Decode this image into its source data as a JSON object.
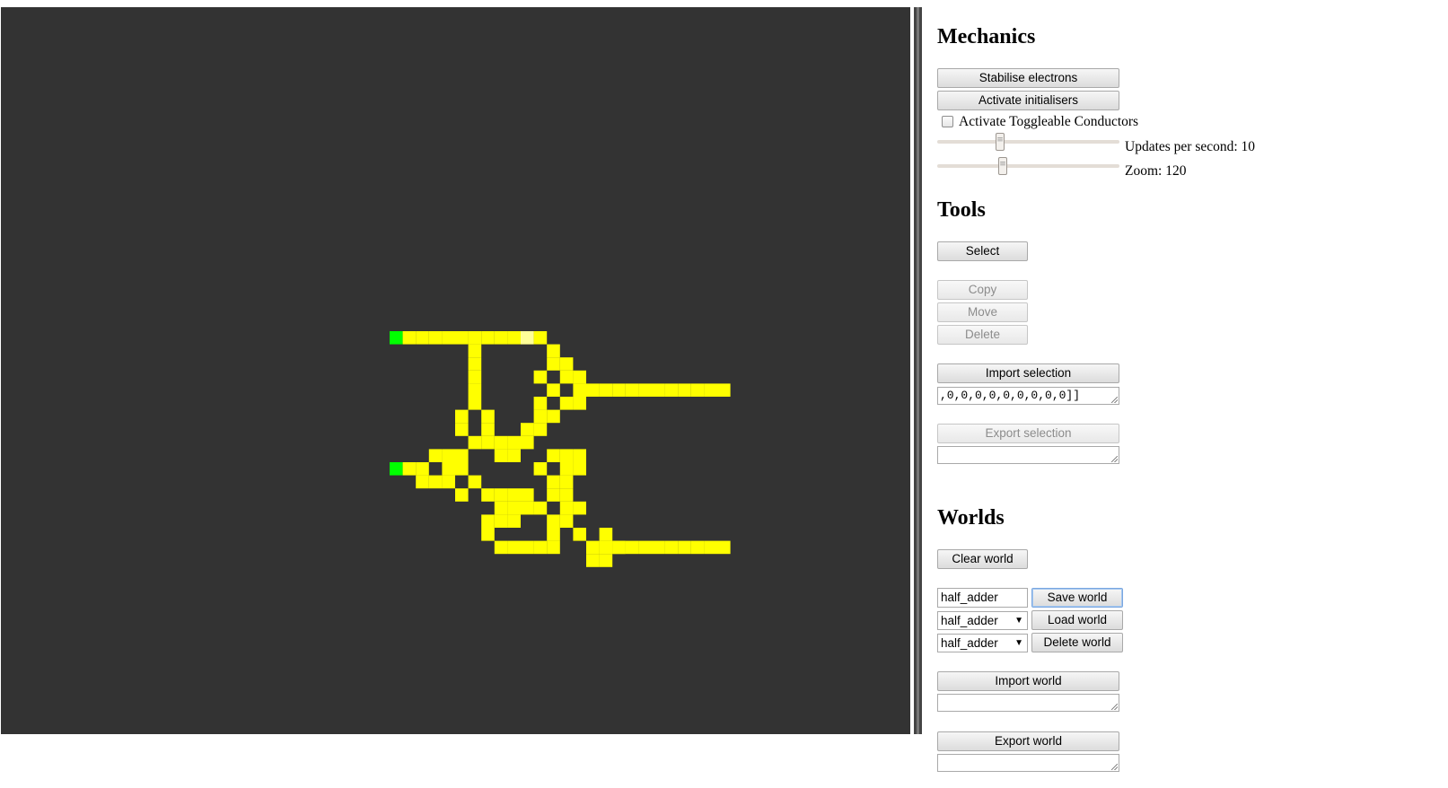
{
  "colors": {
    "canvas_background": "#333333",
    "conductor": "#ffff00",
    "electron_head": "#00ff00",
    "electron_tail": "#ffff99"
  },
  "world_grid": {
    "description_rows": [
      "GGGGGGGGGGGGSGYY",
      "...YYYYYYY.YYY..",
      "..............."
    ]
  },
  "mechanics": {
    "title": "Mechanics",
    "stabilise_label": "Stabilise electrons",
    "activate_init_label": "Activate initialisers",
    "toggle_label": "Activate Toggleable Conductors",
    "toggle_checked": false,
    "updates_label": "Updates per second: 10",
    "updates_value": 10,
    "zoom_label": "Zoom: 120",
    "zoom_value": 120
  },
  "tools": {
    "title": "Tools",
    "select_label": "Select",
    "copy_label": "Copy",
    "move_label": "Move",
    "delete_label": "Delete",
    "import_selection_label": "Import selection",
    "import_selection_value": ",0,0,0,0,0,0,0,0,0]]",
    "export_selection_label": "Export selection",
    "export_selection_value": ""
  },
  "worlds": {
    "title": "Worlds",
    "clear_label": "Clear world",
    "name_value": "half_adder",
    "save_label": "Save world",
    "load_select_value": "half_adder",
    "load_label": "Load world",
    "delete_select_value": "half_adder",
    "delete_label": "Delete world",
    "import_label": "Import world",
    "import_value": "",
    "export_label": "Export world",
    "export_value": ""
  }
}
